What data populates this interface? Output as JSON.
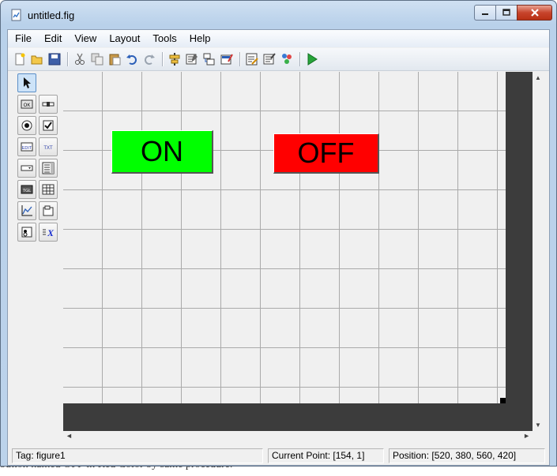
{
  "window": {
    "title": "untitled.fig"
  },
  "background_doc_text": "button named OFF in Red Color by same procedure.",
  "menubar": {
    "items": [
      "File",
      "Edit",
      "View",
      "Layout",
      "Tools",
      "Help"
    ]
  },
  "toolbar": {
    "icons": [
      "new-file-icon",
      "open-folder-icon",
      "save-icon",
      "cut-icon",
      "copy-icon",
      "paste-icon",
      "undo-icon",
      "redo-icon",
      "align-objects-icon",
      "menu-editor-icon",
      "tab-order-editor-icon",
      "toolbar-editor-icon",
      "m-file-editor-icon",
      "property-inspector-icon",
      "object-browser-icon",
      "run-figure-icon"
    ]
  },
  "palette": {
    "tools": [
      "select-tool",
      "push-button-tool",
      "slider-tool",
      "radio-button-tool",
      "checkbox-tool",
      "edit-text-tool",
      "static-text-tool",
      "popup-menu-tool",
      "listbox-tool",
      "toggle-button-tool",
      "table-tool",
      "axes-tool",
      "panel-tool",
      "button-group-tool",
      "activex-control-tool"
    ],
    "labels": {
      "ok": "OK",
      "edit": "EDIT",
      "txt": "TXT",
      "tgl": "TGL",
      "x": "X"
    }
  },
  "canvas": {
    "buttons": [
      {
        "label": "ON",
        "color": "#00ff00"
      },
      {
        "label": "OFF",
        "color": "#ff0000"
      }
    ]
  },
  "statusbar": {
    "tag": "Tag: figure1",
    "current_point": "Current Point:  [154, 1]",
    "position": "Position: [520, 380, 560, 420]"
  },
  "colors": {
    "on_button": "#00ff00",
    "off_button": "#ff0000",
    "canvas_bg": "#f0f0f0",
    "layout_area_dark": "#3c3c3c"
  }
}
